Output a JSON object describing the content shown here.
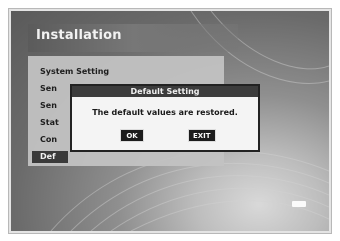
{
  "screen": {
    "title": "Installation"
  },
  "menu": {
    "items": [
      "System Setting",
      "Sen",
      "Sen",
      "Stat",
      "Con",
      "Def"
    ]
  },
  "dialog": {
    "title": "Default Setting",
    "message": "The default values are restored.",
    "ok_label": "OK",
    "exit_label": "EXIT"
  }
}
